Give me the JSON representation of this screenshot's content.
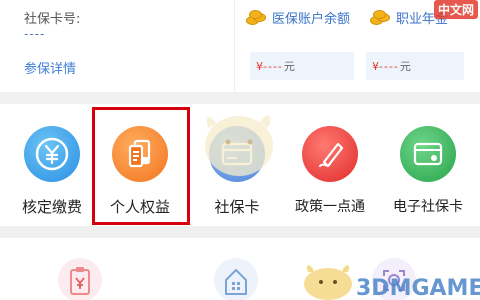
{
  "card": {
    "label": "社保卡号:",
    "number": "----",
    "link": "参保详情"
  },
  "stats": [
    {
      "label": "医保账户余额",
      "symbol": "¥",
      "value": "----",
      "unit": "元",
      "icon": "coin-stack-icon"
    },
    {
      "label": "职业年金",
      "symbol": "¥",
      "value": "----",
      "unit": "元",
      "icon": "coin-stack-icon"
    }
  ],
  "services": [
    {
      "label": "核定缴费",
      "icon": "yen-coin-icon",
      "color": "#2a8fe3"
    },
    {
      "label": "个人权益",
      "icon": "document-stack-icon",
      "color": "#f27420"
    },
    {
      "label": "社保卡",
      "icon": "card-icon",
      "color": "#4f86dc"
    },
    {
      "label": "政策一点通",
      "icon": "pen-icon",
      "color": "#e02a2a"
    },
    {
      "label": "电子社保卡",
      "icon": "e-card-icon",
      "color": "#27a44a"
    }
  ],
  "bottom_services": [
    {
      "icon": "yen-clipboard-icon"
    },
    {
      "icon": "building-icon"
    },
    {
      "icon": "face-scan-icon"
    }
  ],
  "highlight_color": "#d8000f",
  "watermark_top": "中文网",
  "watermark_bottom": "3DMGAME"
}
